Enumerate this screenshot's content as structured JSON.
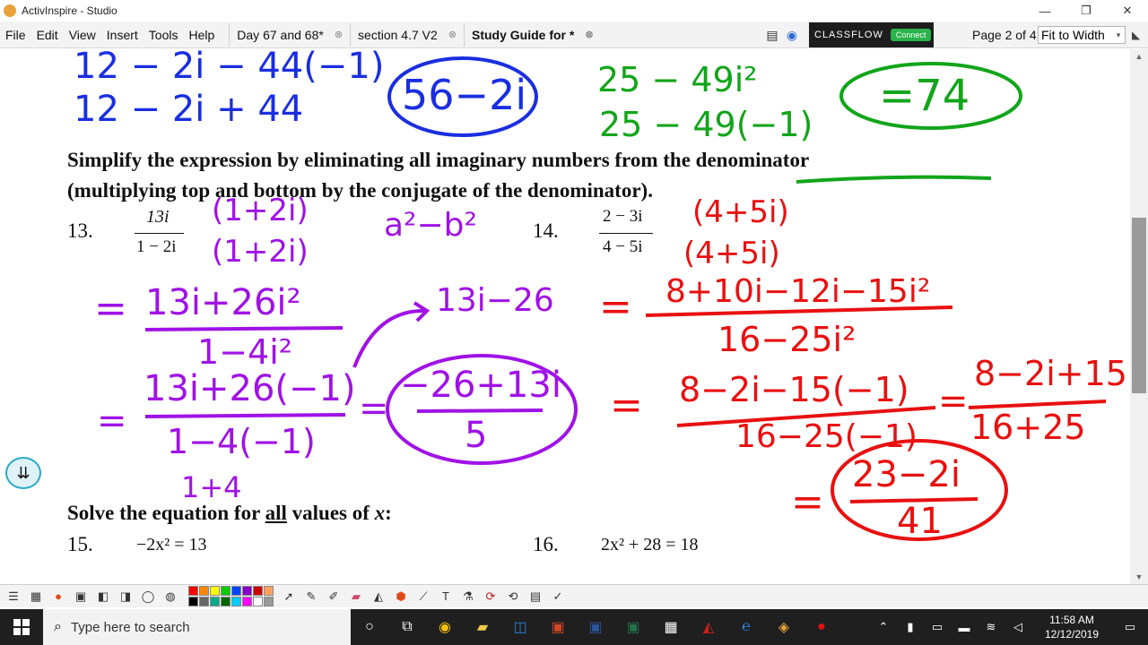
{
  "window": {
    "title": "ActivInspire - Studio",
    "minimize": "—",
    "restore": "❐",
    "close": "✕"
  },
  "menu": [
    "File",
    "Edit",
    "View",
    "Insert",
    "Tools",
    "Help"
  ],
  "tabs": [
    {
      "label": "Day 67 and 68*",
      "close": "⊗"
    },
    {
      "label": "section 4.7 V2",
      "close": "⊗"
    },
    {
      "label": "Study Guide for *",
      "close": "⊗"
    }
  ],
  "classflow": {
    "label": "CLASSFLOW",
    "connect": "Connect"
  },
  "page_indicator": "Page 2 of 4",
  "zoom": {
    "value": "Fit to Width",
    "arrow": "▾"
  },
  "sheet": {
    "instruction_line1": "Simplify the expression by eliminating all imaginary numbers from the denominator",
    "instruction_line2": "(multiplying top and bottom by the conjugate of the denominator).",
    "p13_num": "13.",
    "p13_top": "13i",
    "p13_bottom": "1 − 2i",
    "p14_num": "14.",
    "p14_top": "2 − 3i",
    "p14_bottom": "4 − 5i",
    "solve_heading_a": "Solve the equation for ",
    "solve_heading_b": "all",
    "solve_heading_c": " values of ",
    "solve_heading_d": "x",
    "solve_heading_e": ":",
    "p15_num": "15.",
    "p15_expr": "−2x² = 13",
    "p16_num": "16.",
    "p16_expr": "2x² + 28 = 18"
  },
  "ink": {
    "blue_line1": "12 − 2i − 44(−1)",
    "blue_line2": "12 − 2i + 44",
    "blue_answer": "56−2i",
    "green_line1": "25 − 49i²",
    "green_line2": "25 − 49(−1)",
    "green_answer": "=74",
    "p13_conj_top": "(1+2i)",
    "p13_conj_bottom": "(1+2i)",
    "p13_note": "a²−b²",
    "p13_step1_top": "13i+26i²",
    "p13_step1_bottom": "1−4i²",
    "p13_side": "13i−26",
    "p13_step2_top": "13i+26(−1)",
    "p13_step2_bottom": "1−4(−1)",
    "p13_step2_extra": "1+4",
    "p13_answer_top": "−26+13i",
    "p13_answer_bottom": "5",
    "p14_conj_top": "(4+5i)",
    "p14_conj_bottom": "(4+5i)",
    "p14_step1_top": "8+10i−12i−15i²",
    "p14_step1_bottom": "16−25i²",
    "p14_step2_top": "8−2i−15(−1)",
    "p14_step2_bottom": "16−25(−1)",
    "p14_step3_top": "8−2i+15",
    "p14_step3_bottom": "16+25",
    "p14_answer_top": "23−2i",
    "p14_answer_bottom": "41",
    "eq": "="
  },
  "taskbar": {
    "search_placeholder": "Type here to search",
    "time": "11:58 AM",
    "date": "12/12/2019"
  },
  "colors": {
    "blue": "#1a2ee0",
    "green": "#12a51a",
    "purple": "#a012e6",
    "red": "#e81010"
  }
}
